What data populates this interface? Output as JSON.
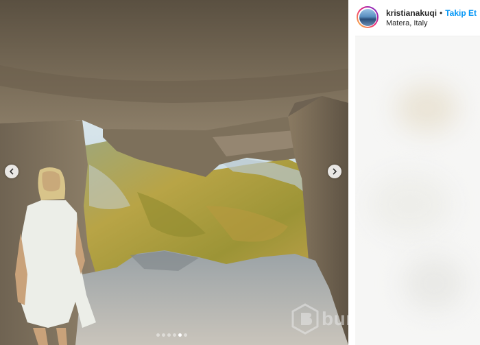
{
  "post": {
    "image_alt": "Woman standing inside a rock-cut cave looking out at a green valley",
    "carousel_total": 6,
    "carousel_active": 5
  },
  "header": {
    "username": "kristianakuqi",
    "separator": "•",
    "follow_label": "Takip Et",
    "location": "Matera, Italy"
  },
  "watermark": {
    "text": "bursa"
  },
  "colors": {
    "follow_blue": "#0095f6",
    "text_dark": "#262626",
    "rock": "#8a7b66",
    "foliage": "#a89a3a"
  },
  "icons": {
    "prev": "chevron-left-icon",
    "next": "chevron-right-icon",
    "watermark_logo": "bursa-logo-icon"
  }
}
